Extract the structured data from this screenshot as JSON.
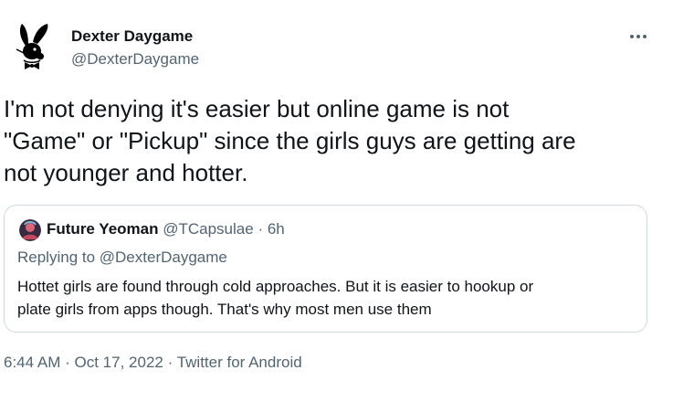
{
  "author": {
    "display_name": "Dexter Daygame",
    "handle": "@DexterDaygame",
    "avatar_icon": "playboy-bunny-icon"
  },
  "more_icon": "ellipsis-icon",
  "tweet": {
    "text": "I'm not denying it's easier but online game is not\n\"Game\" or \"Pickup\" since the girls guys are getting are\nnot younger and hotter."
  },
  "quote": {
    "display_name": "Future Yeoman",
    "handle": "@TCapsulae",
    "separator": "·",
    "time": "6h",
    "replying_to": "Replying to @DexterDaygame",
    "text": "Hottet girls are found through cold approaches. But it is easier to hookup or\nplate girls from apps though. That's why most men use them"
  },
  "meta": {
    "time": "6:44 AM",
    "separator": "·",
    "date": "Oct 17, 2022",
    "source": "Twitter for Android"
  },
  "colors": {
    "primary_text": "#0f1419",
    "secondary_text": "#536471",
    "border": "#cfd9de"
  }
}
